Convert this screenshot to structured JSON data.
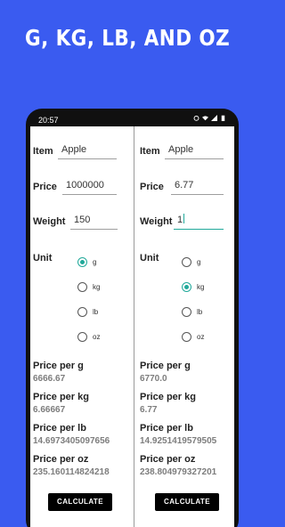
{
  "hero_title": "G, KG, LB, AND OZ",
  "status": {
    "time": "20:57"
  },
  "labels": {
    "item": "Item",
    "price": "Price",
    "weight": "Weight",
    "unit": "Unit",
    "per_g": "Price per g",
    "per_kg": "Price per kg",
    "per_lb": "Price per lb",
    "per_oz": "Price per oz",
    "calculate": "CALCULATE"
  },
  "units": [
    "g",
    "kg",
    "lb",
    "oz"
  ],
  "left": {
    "item": "Apple",
    "price": "1000000",
    "weight": "150",
    "selected_unit": "g",
    "results": {
      "g": "6666.67",
      "kg": "6.66667",
      "lb": "14.6973405097656",
      "oz": "235.160114824218"
    }
  },
  "right": {
    "item": "Apple",
    "price": "6.77",
    "weight": "1",
    "selected_unit": "kg",
    "results": {
      "g": "6770.0",
      "kg": "6.77",
      "lb": "14.9251419579505",
      "oz": "238.804979327201"
    }
  },
  "colors": {
    "background": "#3a5bf0",
    "accent": "#21a99a"
  }
}
